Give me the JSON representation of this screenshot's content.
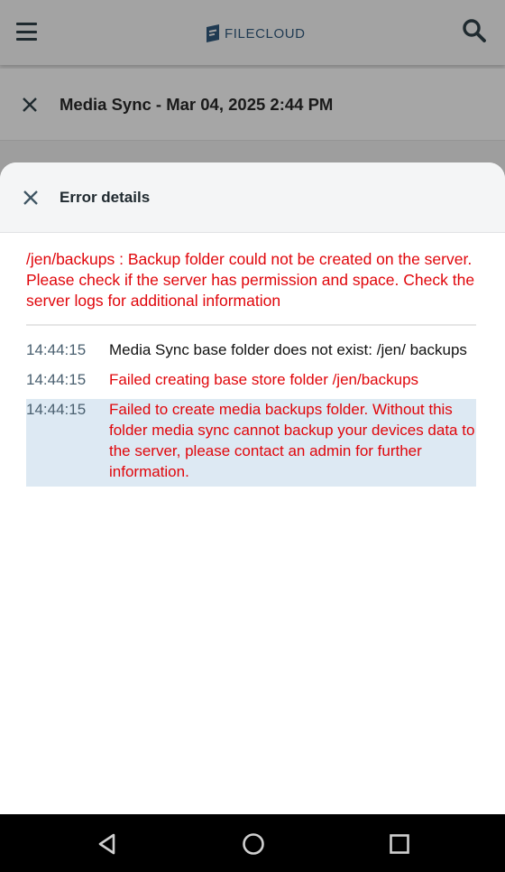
{
  "app_bar": {
    "brand": "FILECLOUD",
    "menu_icon": "hamburger-icon",
    "search_icon": "search-icon"
  },
  "sync_header": {
    "title": "Media Sync - Mar 04, 2025 2:44 PM",
    "close_icon": "close-icon"
  },
  "error_sheet": {
    "title": "Error details",
    "close_icon": "close-icon",
    "summary": "/jen/backups : Backup folder could not be created on the server. Please check if the server has permission and space. Check the server logs for additional information",
    "log": [
      {
        "time": "14:44:15",
        "message": "Media Sync base folder does not exist: /jen/ backups",
        "level": "info"
      },
      {
        "time": "14:44:15",
        "message": "Failed creating base store folder /jen/backups",
        "level": "error"
      },
      {
        "time": "14:44:15",
        "message": "Failed to create media backups folder. Without this folder media sync cannot backup your devices data to the server, please contact an admin for further information.",
        "level": "error",
        "selected": true
      }
    ]
  },
  "nav_bar": {
    "back_icon": "back-triangle-icon",
    "home_icon": "home-circle-icon",
    "recents_icon": "recents-square-icon"
  },
  "colors": {
    "error": "#e0060b",
    "highlight": "#dde9f3",
    "brand": "#1f3a52"
  }
}
